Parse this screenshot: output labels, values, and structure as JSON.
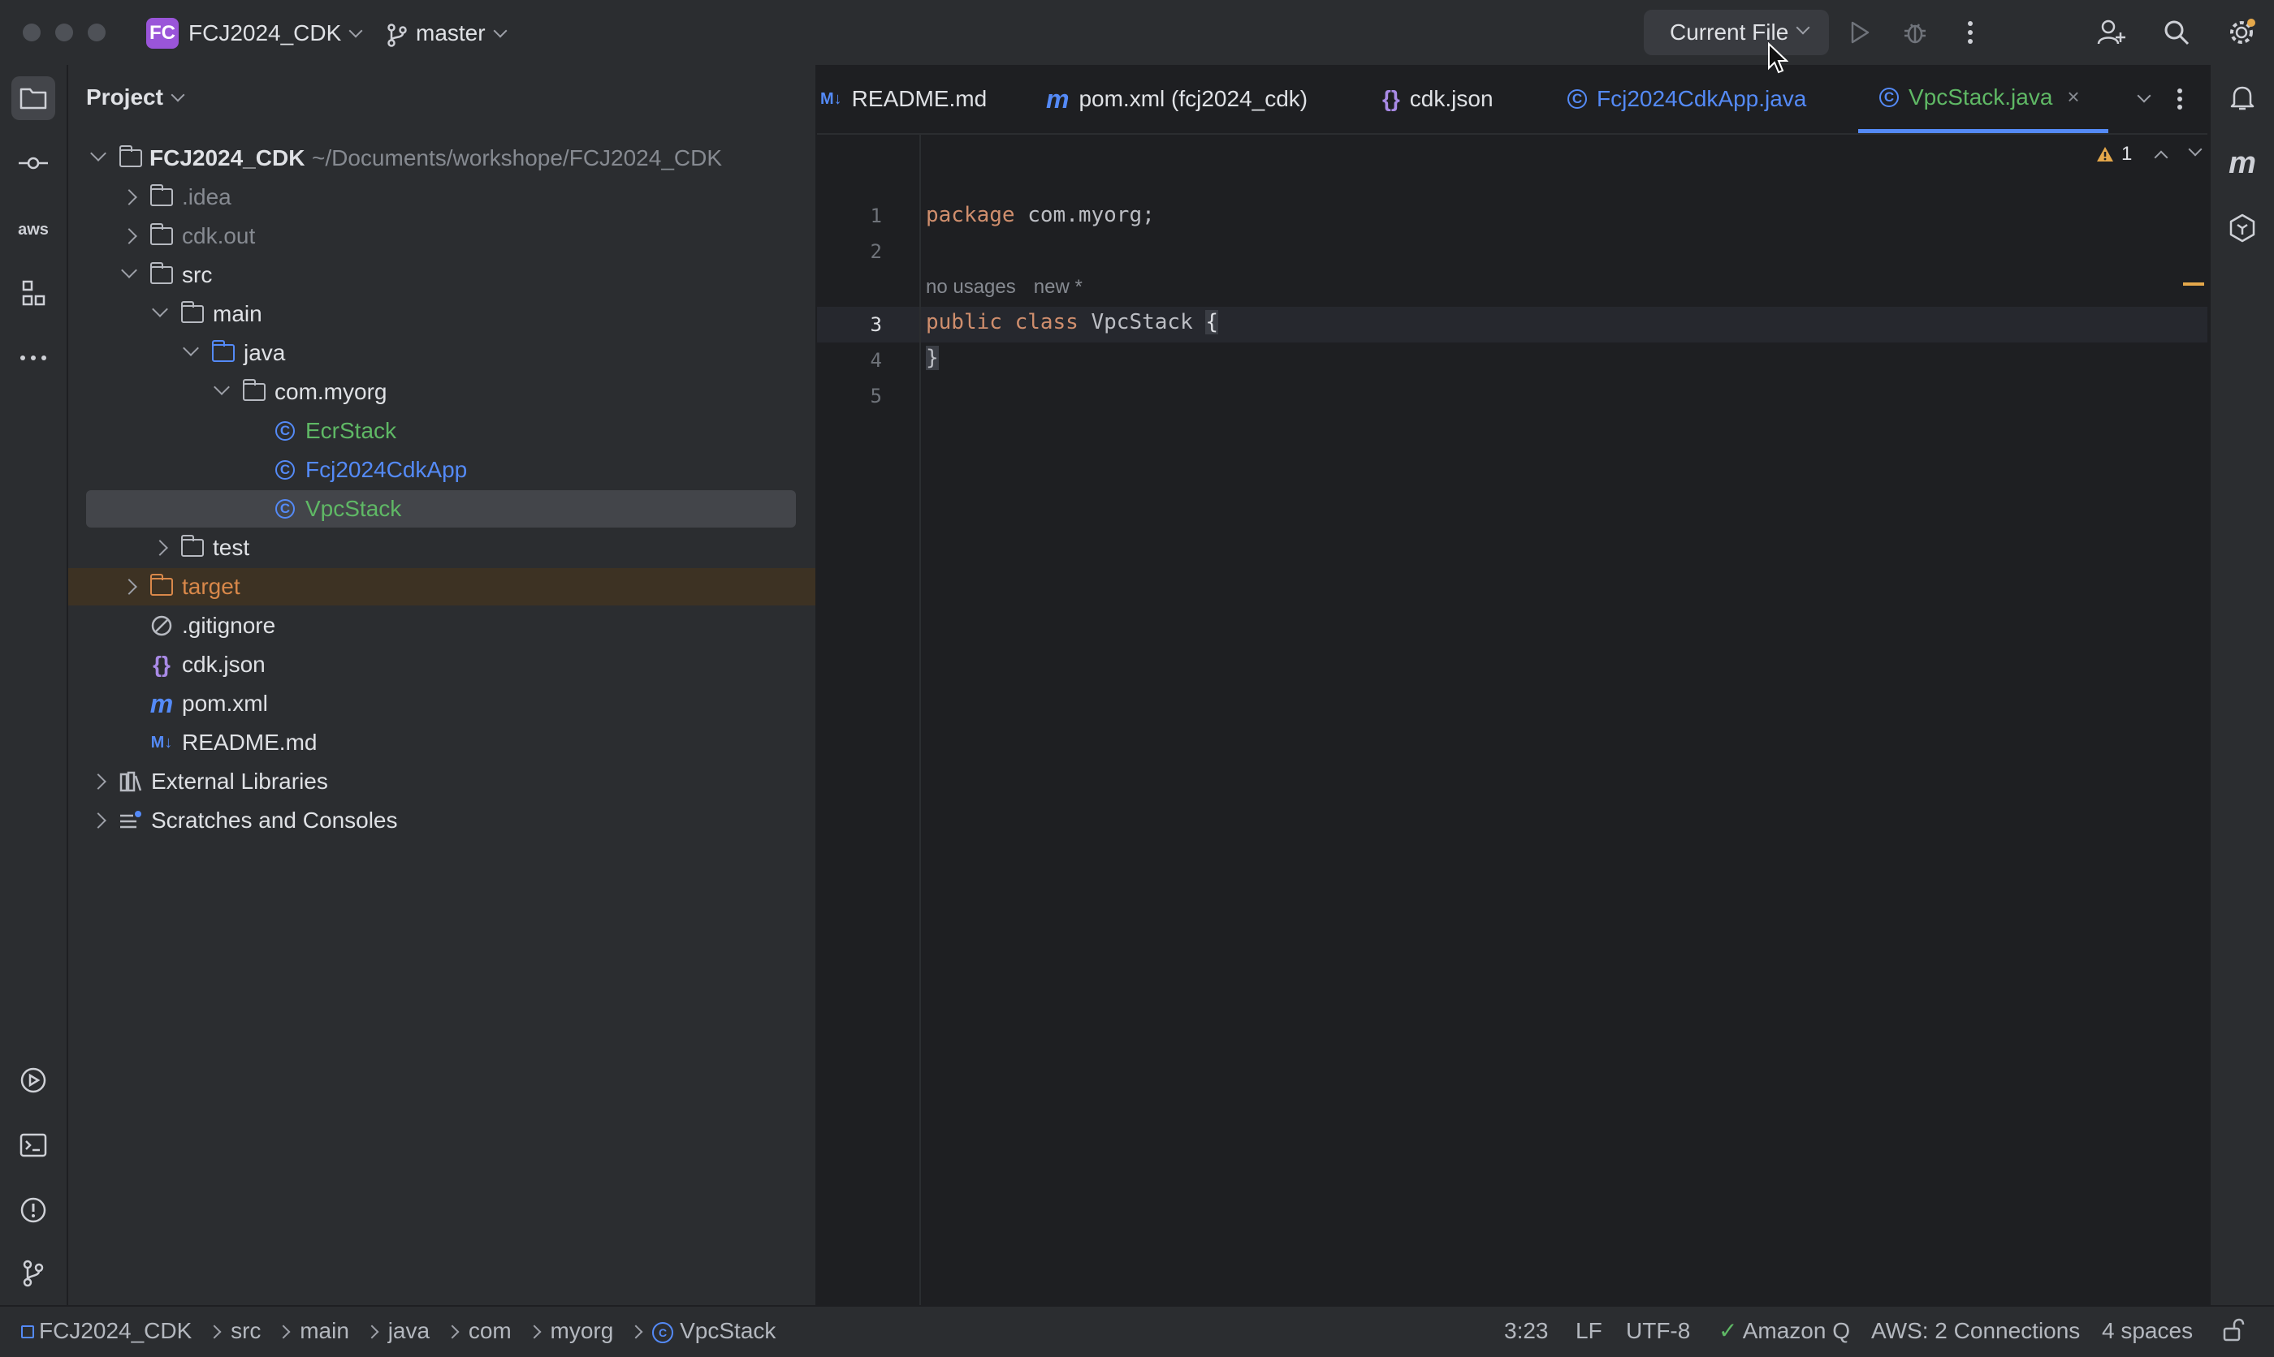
{
  "titlebar": {
    "project_badge": "FC",
    "project_name": "FCJ2024_CDK",
    "branch": "master",
    "run_config": "Current File"
  },
  "project_panel": {
    "title": "Project",
    "root_name": "FCJ2024_CDK",
    "root_path": "~/Documents/workshope/FCJ2024_CDK",
    "items": [
      {
        "label": ".idea"
      },
      {
        "label": "cdk.out"
      },
      {
        "label": "src"
      },
      {
        "label": "main"
      },
      {
        "label": "java"
      },
      {
        "label": "com.myorg"
      },
      {
        "label": "EcrStack"
      },
      {
        "label": "Fcj2024CdkApp"
      },
      {
        "label": "VpcStack"
      },
      {
        "label": "test"
      },
      {
        "label": "target"
      },
      {
        "label": ".gitignore"
      },
      {
        "label": "cdk.json"
      },
      {
        "label": "pom.xml"
      },
      {
        "label": "README.md"
      },
      {
        "label": "External Libraries"
      },
      {
        "label": "Scratches and Consoles"
      }
    ]
  },
  "tabs": [
    {
      "icon": "M↓",
      "label": "README.md"
    },
    {
      "icon": "m",
      "label": "pom.xml (fcj2024_cdk)"
    },
    {
      "icon": "{}",
      "label": "cdk.json"
    },
    {
      "icon": "C",
      "label": "Fcj2024CdkApp.java"
    },
    {
      "icon": "C",
      "label": "VpcStack.java"
    }
  ],
  "editor": {
    "line_numbers": [
      "1",
      "2",
      "3",
      "4",
      "5"
    ],
    "line1_kw": "package",
    "line1_rest": " com.myorg;",
    "hint_usages": "no usages",
    "hint_new": "new *",
    "line3_kw": "public class",
    "line3_cls": " VpcStack ",
    "line3_brace": "{",
    "line4": "}",
    "warning_count": "1"
  },
  "statusbar": {
    "breadcrumbs": [
      "FCJ2024_CDK",
      "src",
      "main",
      "java",
      "com",
      "myorg",
      "VpcStack"
    ],
    "position": "3:23",
    "line_sep": "LF",
    "encoding": "UTF-8",
    "amazon_q": "Amazon Q",
    "aws": "AWS: 2 Connections",
    "indent": "4 spaces"
  },
  "colors": {
    "accent": "#548af7",
    "bg": "#1e1f22",
    "panel": "#2b2d30",
    "keyword": "#cf8e6d",
    "vcs_added": "#5fb865",
    "ignored": "#d9884a"
  }
}
